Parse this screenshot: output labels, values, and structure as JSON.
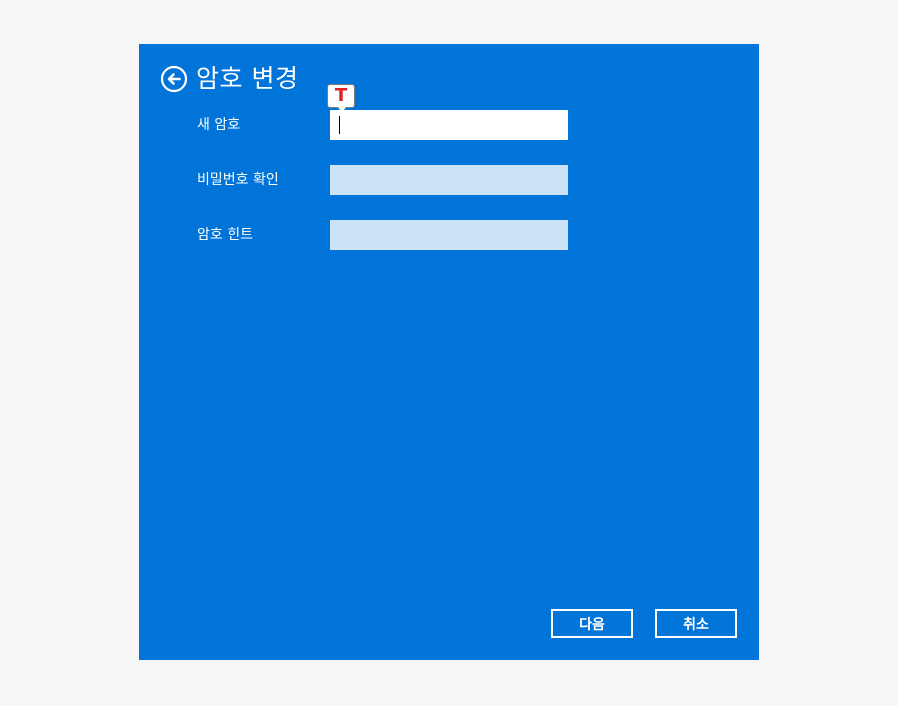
{
  "dialog": {
    "title": "암호 변경",
    "back_icon": "back-arrow-circle-icon",
    "colors": {
      "background": "#0074d9",
      "active_field": "#ffffff",
      "inactive_field": "#cce3f7",
      "ime_indicator": "#e02020"
    }
  },
  "form": {
    "new_password": {
      "label": "새 암호",
      "value": ""
    },
    "confirm_password": {
      "label": "비밀번호 확인",
      "value": ""
    },
    "password_hint": {
      "label": "암호 힌트",
      "value": ""
    }
  },
  "ime": {
    "indicator_text": "T"
  },
  "buttons": {
    "next_label": "다음",
    "cancel_label": "취소"
  }
}
